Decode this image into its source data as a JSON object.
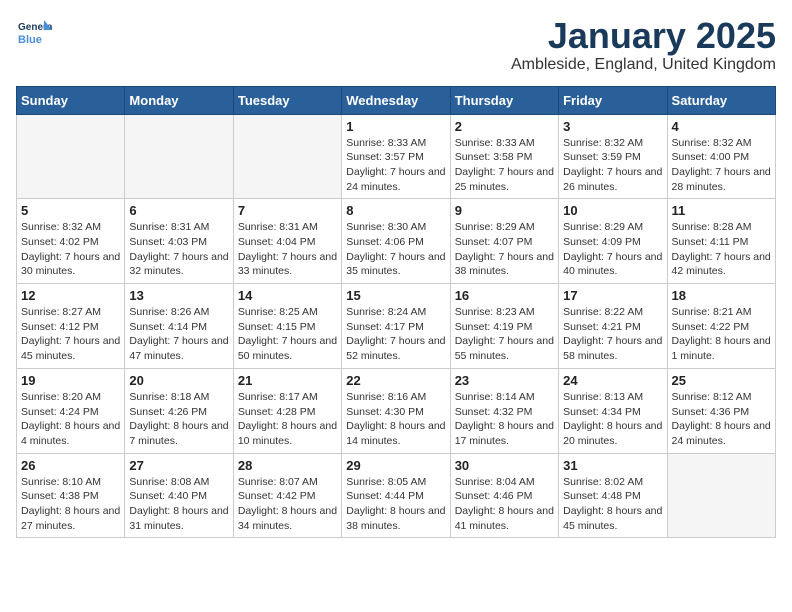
{
  "logo": {
    "line1": "General",
    "line2": "Blue"
  },
  "title": "January 2025",
  "location": "Ambleside, England, United Kingdom",
  "days_of_week": [
    "Sunday",
    "Monday",
    "Tuesday",
    "Wednesday",
    "Thursday",
    "Friday",
    "Saturday"
  ],
  "weeks": [
    [
      {
        "day": "",
        "empty": true
      },
      {
        "day": "",
        "empty": true
      },
      {
        "day": "",
        "empty": true
      },
      {
        "day": "1",
        "sunrise": "8:33 AM",
        "sunset": "3:57 PM",
        "daylight": "7 hours and 24 minutes."
      },
      {
        "day": "2",
        "sunrise": "8:33 AM",
        "sunset": "3:58 PM",
        "daylight": "7 hours and 25 minutes."
      },
      {
        "day": "3",
        "sunrise": "8:32 AM",
        "sunset": "3:59 PM",
        "daylight": "7 hours and 26 minutes."
      },
      {
        "day": "4",
        "sunrise": "8:32 AM",
        "sunset": "4:00 PM",
        "daylight": "7 hours and 28 minutes."
      }
    ],
    [
      {
        "day": "5",
        "sunrise": "8:32 AM",
        "sunset": "4:02 PM",
        "daylight": "7 hours and 30 minutes."
      },
      {
        "day": "6",
        "sunrise": "8:31 AM",
        "sunset": "4:03 PM",
        "daylight": "7 hours and 32 minutes."
      },
      {
        "day": "7",
        "sunrise": "8:31 AM",
        "sunset": "4:04 PM",
        "daylight": "7 hours and 33 minutes."
      },
      {
        "day": "8",
        "sunrise": "8:30 AM",
        "sunset": "4:06 PM",
        "daylight": "7 hours and 35 minutes."
      },
      {
        "day": "9",
        "sunrise": "8:29 AM",
        "sunset": "4:07 PM",
        "daylight": "7 hours and 38 minutes."
      },
      {
        "day": "10",
        "sunrise": "8:29 AM",
        "sunset": "4:09 PM",
        "daylight": "7 hours and 40 minutes."
      },
      {
        "day": "11",
        "sunrise": "8:28 AM",
        "sunset": "4:11 PM",
        "daylight": "7 hours and 42 minutes."
      }
    ],
    [
      {
        "day": "12",
        "sunrise": "8:27 AM",
        "sunset": "4:12 PM",
        "daylight": "7 hours and 45 minutes."
      },
      {
        "day": "13",
        "sunrise": "8:26 AM",
        "sunset": "4:14 PM",
        "daylight": "7 hours and 47 minutes."
      },
      {
        "day": "14",
        "sunrise": "8:25 AM",
        "sunset": "4:15 PM",
        "daylight": "7 hours and 50 minutes."
      },
      {
        "day": "15",
        "sunrise": "8:24 AM",
        "sunset": "4:17 PM",
        "daylight": "7 hours and 52 minutes."
      },
      {
        "day": "16",
        "sunrise": "8:23 AM",
        "sunset": "4:19 PM",
        "daylight": "7 hours and 55 minutes."
      },
      {
        "day": "17",
        "sunrise": "8:22 AM",
        "sunset": "4:21 PM",
        "daylight": "7 hours and 58 minutes."
      },
      {
        "day": "18",
        "sunrise": "8:21 AM",
        "sunset": "4:22 PM",
        "daylight": "8 hours and 1 minute."
      }
    ],
    [
      {
        "day": "19",
        "sunrise": "8:20 AM",
        "sunset": "4:24 PM",
        "daylight": "8 hours and 4 minutes."
      },
      {
        "day": "20",
        "sunrise": "8:18 AM",
        "sunset": "4:26 PM",
        "daylight": "8 hours and 7 minutes."
      },
      {
        "day": "21",
        "sunrise": "8:17 AM",
        "sunset": "4:28 PM",
        "daylight": "8 hours and 10 minutes."
      },
      {
        "day": "22",
        "sunrise": "8:16 AM",
        "sunset": "4:30 PM",
        "daylight": "8 hours and 14 minutes."
      },
      {
        "day": "23",
        "sunrise": "8:14 AM",
        "sunset": "4:32 PM",
        "daylight": "8 hours and 17 minutes."
      },
      {
        "day": "24",
        "sunrise": "8:13 AM",
        "sunset": "4:34 PM",
        "daylight": "8 hours and 20 minutes."
      },
      {
        "day": "25",
        "sunrise": "8:12 AM",
        "sunset": "4:36 PM",
        "daylight": "8 hours and 24 minutes."
      }
    ],
    [
      {
        "day": "26",
        "sunrise": "8:10 AM",
        "sunset": "4:38 PM",
        "daylight": "8 hours and 27 minutes."
      },
      {
        "day": "27",
        "sunrise": "8:08 AM",
        "sunset": "4:40 PM",
        "daylight": "8 hours and 31 minutes."
      },
      {
        "day": "28",
        "sunrise": "8:07 AM",
        "sunset": "4:42 PM",
        "daylight": "8 hours and 34 minutes."
      },
      {
        "day": "29",
        "sunrise": "8:05 AM",
        "sunset": "4:44 PM",
        "daylight": "8 hours and 38 minutes."
      },
      {
        "day": "30",
        "sunrise": "8:04 AM",
        "sunset": "4:46 PM",
        "daylight": "8 hours and 41 minutes."
      },
      {
        "day": "31",
        "sunrise": "8:02 AM",
        "sunset": "4:48 PM",
        "daylight": "8 hours and 45 minutes."
      },
      {
        "day": "",
        "empty": true
      }
    ]
  ]
}
